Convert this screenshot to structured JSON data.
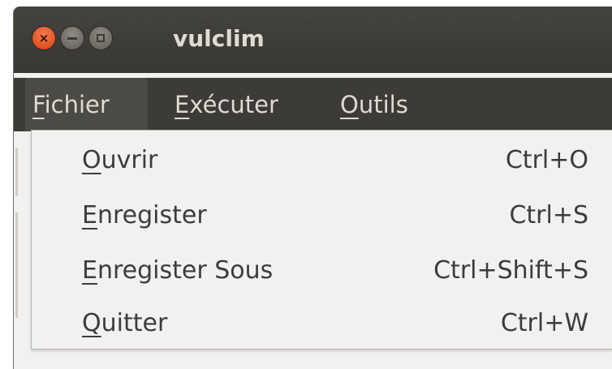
{
  "window": {
    "title": "vulclim",
    "controls": [
      {
        "name": "close",
        "glyph": "×"
      },
      {
        "name": "minimize",
        "glyph": ""
      },
      {
        "name": "maximize",
        "glyph": ""
      }
    ]
  },
  "menubar": {
    "items": [
      {
        "first": "F",
        "rest": "ichier",
        "active": true
      },
      {
        "first": "E",
        "rest": "xécuter",
        "active": false
      },
      {
        "first": "O",
        "rest": "utils",
        "active": false
      }
    ]
  },
  "file_menu": {
    "items": [
      {
        "first": "O",
        "rest": "uvrir",
        "accel": "Ctrl+O"
      },
      {
        "first": "E",
        "rest": "nregister",
        "accel": "Ctrl+S"
      },
      {
        "first": "E",
        "rest": "nregister Sous",
        "accel": "Ctrl+Shift+S"
      },
      {
        "first": "Q",
        "rest": "uitter",
        "accel": "Ctrl+W"
      }
    ]
  },
  "colors": {
    "titlebar": "#3c3b37",
    "menu_text": "#dfdbd2",
    "close_button": "#e2521f",
    "dropdown_bg": "#f2f1f0"
  },
  "icons": [
    "close-icon",
    "minimize-icon",
    "maximize-icon"
  ]
}
